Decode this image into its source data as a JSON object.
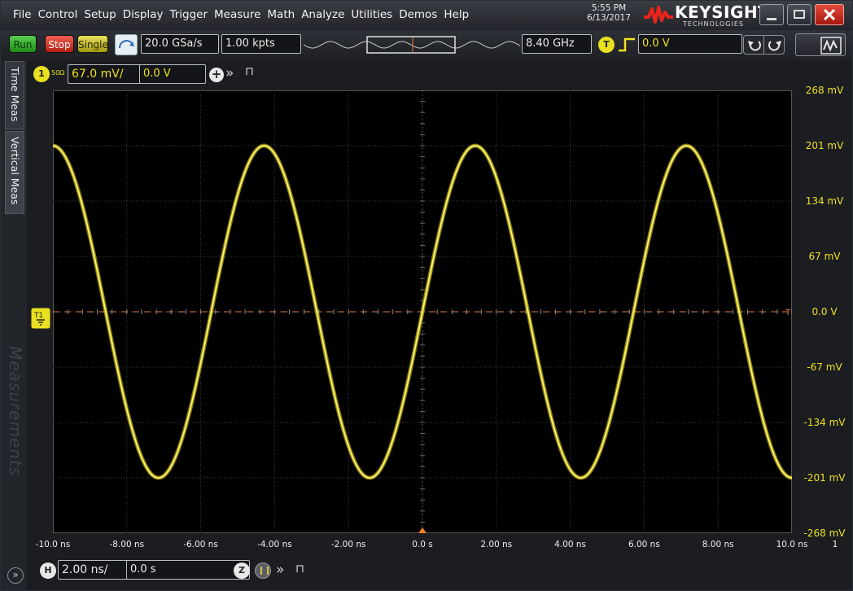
{
  "menu": [
    "File",
    "Control",
    "Setup",
    "Display",
    "Trigger",
    "Measure",
    "Math",
    "Analyze",
    "Utilities",
    "Demos",
    "Help"
  ],
  "clock": {
    "time": "5:55 PM",
    "date": "6/13/2017"
  },
  "brand": {
    "name": "KEYSIGHT",
    "sub": "TECHNOLOGIES"
  },
  "toolbar": {
    "run": "Run",
    "stop": "Stop",
    "single": "Single",
    "sample_rate": "20.0 GSa/s",
    "memory_depth": "1.00 kpts",
    "bandwidth": "8.40 GHz",
    "trigger_badge": "T",
    "trigger_level": "0.0 V"
  },
  "left_tabs": {
    "time_meas": "Time Meas",
    "vertical_meas": "Vertical Meas",
    "measurements": "Measurements",
    "expand": "»"
  },
  "channel": {
    "number": "1",
    "impedance": "50Ω",
    "scale": "67.0 mV/",
    "offset": "0.0 V",
    "color": "#f0e020"
  },
  "horizontal": {
    "badge": "H",
    "scale": "2.00 ns/",
    "position": "0.0 s",
    "zoom": "Z"
  },
  "y_labels": [
    "268 mV",
    "201 mV",
    "134 mV",
    "67 mV",
    "0.0 V",
    "-67 mV",
    "-134 mV",
    "-201 mV",
    "-268 mV"
  ],
  "x_labels": [
    "-10.0 ns",
    "-8.00 ns",
    "-6.00 ns",
    "-4.00 ns",
    "-2.00 ns",
    "0.0 s",
    "2.00 ns",
    "4.00 ns",
    "6.00 ns",
    "8.00 ns",
    "10.0 ns"
  ],
  "x_label_extra": "1",
  "waveform": {
    "frequency_hz": 175000000,
    "amplitude_mV": 201,
    "phase_zero_crossing_ns": 0.0,
    "trace_color": "#f0e020",
    "trigger_line_color": "#e07a40"
  }
}
